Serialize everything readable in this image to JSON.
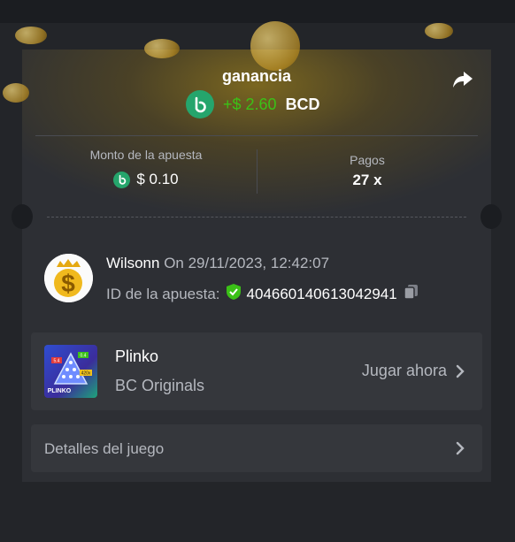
{
  "header": {
    "title": "ganancia",
    "win_amount": "+$ 2.60",
    "currency": "BCD"
  },
  "stats": {
    "bet_amount_label": "Monto de la apuesta",
    "bet_amount_value": "$ 0.10",
    "payout_label": "Pagos",
    "payout_value": "27 x"
  },
  "bet": {
    "username": "Wilsonn",
    "date_text": "On 29/11/2023, 12:42:07",
    "id_label": "ID de la apuesta:",
    "id_value": "404660140613042941"
  },
  "game": {
    "name": "Plinko",
    "provider": "BC Originals",
    "play_label": "Jugar ahora",
    "thumb_text": "PLINKO",
    "thumb_badges": [
      "5.4",
      "0.4",
      "420x"
    ]
  },
  "details": {
    "label": "Detalles del juego"
  },
  "colors": {
    "accent_green": "#3bc117",
    "bc_logo": "#25a56c",
    "card_bg": "#2d2f34",
    "panel_bg": "#35373c"
  },
  "icons": [
    "bc-coin-icon",
    "share-icon",
    "shield-check-icon",
    "copy-icon",
    "chevron-right-icon",
    "gold-dollar-avatar"
  ]
}
